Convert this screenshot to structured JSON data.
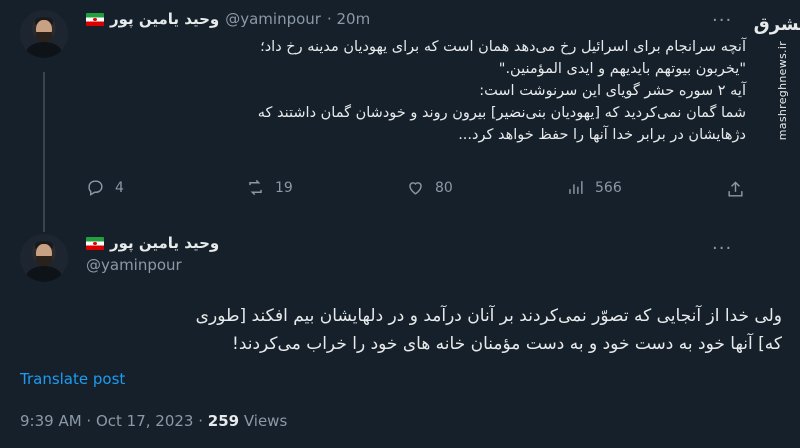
{
  "tweet1": {
    "name": "وحید یامین پور",
    "handle": "@yaminpour",
    "time": "· 20m",
    "text_lines": [
      "آنچه سرانجام برای اسرائیل رخ می‌دهد همان است که برای یهودیان مدینه رخ داد؛",
      "\"یخربون بیوتهم بایدیهم و ایدی المؤمنین.\"",
      "آیه ۲ سوره حشر گویای این سرنوشت است:",
      "شما گمان نمی‌کردید که [یهودیان بنی‌نضیر] بیرون روند و خودشان گمان داشتند که",
      "دژهایشان در برابر خدا آنها را حفظ خواهد کرد..."
    ],
    "actions": {
      "replies": "4",
      "reposts": "19",
      "likes": "80",
      "views": "566"
    }
  },
  "tweet2": {
    "name": "وحید یامین پور",
    "handle": "@yaminpour",
    "text_lines": [
      "ولی خدا از آنجایی که تصوّر نمی‌کردند بر آنان درآمد و در دلهایشان بیم افکند [طوری",
      "که] آنها خود به دست خود و به دست مؤمنان خانه های خود را خراب می‌کردند!"
    ],
    "translate_label": "Translate post",
    "timestamp": "9:39 AM · Oct 17, 2023 · ",
    "views_count": "259",
    "views_label": " Views"
  },
  "watermark": {
    "logo": "مشرق",
    "url": "mashreghnews.ir"
  },
  "colors": {
    "background": "#15202b",
    "text": "#e7e9ea",
    "secondary": "#8b98a5",
    "link": "#1d9bf0"
  }
}
